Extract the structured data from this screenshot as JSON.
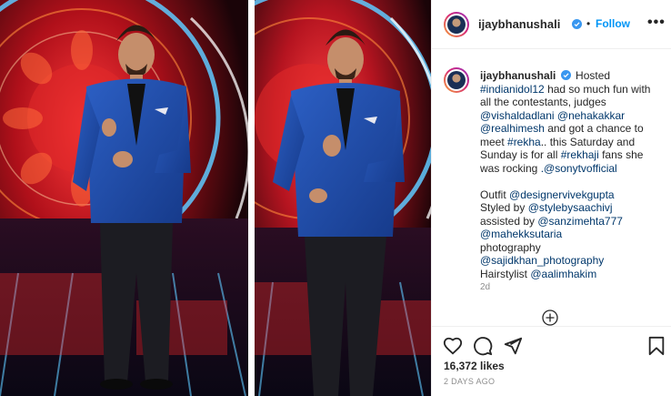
{
  "post": {
    "username": "ijaybhanushali",
    "follow_label": "Follow",
    "separator": "•",
    "more_label": "•••",
    "caption": {
      "segments": [
        {
          "t": "Hosted ",
          "k": "text"
        },
        {
          "t": "#indianidol12",
          "k": "link"
        },
        {
          "t": " had so much fun with all the contestants, judges ",
          "k": "text"
        },
        {
          "t": "@vishaldadlani",
          "k": "link"
        },
        {
          "t": " ",
          "k": "text"
        },
        {
          "t": "@nehakakkar",
          "k": "link"
        },
        {
          "t": " ",
          "k": "text"
        },
        {
          "t": "@realhimesh",
          "k": "link"
        },
        {
          "t": " and got a chance to meet ",
          "k": "text"
        },
        {
          "t": "#rekha",
          "k": "link"
        },
        {
          "t": ".. this Saturday and Sunday is for all ",
          "k": "text"
        },
        {
          "t": "#rekhaji",
          "k": "link"
        },
        {
          "t": " fans she was rocking ",
          "k": "text"
        },
        {
          "t": ".@sonytvofficial",
          "k": "link"
        },
        {
          "t": "\n\nOutfit ",
          "k": "text"
        },
        {
          "t": "@designervivekgupta",
          "k": "link"
        },
        {
          "t": "\nStyled by ",
          "k": "text"
        },
        {
          "t": "@stylebysaachivj",
          "k": "link"
        },
        {
          "t": "\nassisted by ",
          "k": "text"
        },
        {
          "t": "@sanzimehta777",
          "k": "link"
        },
        {
          "t": "\n",
          "k": "text"
        },
        {
          "t": "@mahekksutaria",
          "k": "link"
        },
        {
          "t": "\nphotography\n",
          "k": "text"
        },
        {
          "t": "@sajidkhan_photography",
          "k": "link"
        },
        {
          "t": "\nHairstylist ",
          "k": "text"
        },
        {
          "t": "@aalimhakim",
          "k": "link"
        }
      ]
    },
    "time_ago": "2d",
    "likes": "16,372 likes",
    "date": "2 DAYS AGO"
  },
  "icons": {
    "like": "heart-icon",
    "comment": "comment-icon",
    "share": "share-icon",
    "save": "bookmark-icon",
    "verified": "verified-badge-icon",
    "add_comment": "add-comment-icon",
    "more": "more-options-icon"
  },
  "colors": {
    "link": "#00376b",
    "follow": "#0095f6",
    "verified": "#3897f0",
    "muted": "#8e8e8e",
    "stage_red": "#d4141f",
    "jacket_blue": "#1f4fb0"
  }
}
